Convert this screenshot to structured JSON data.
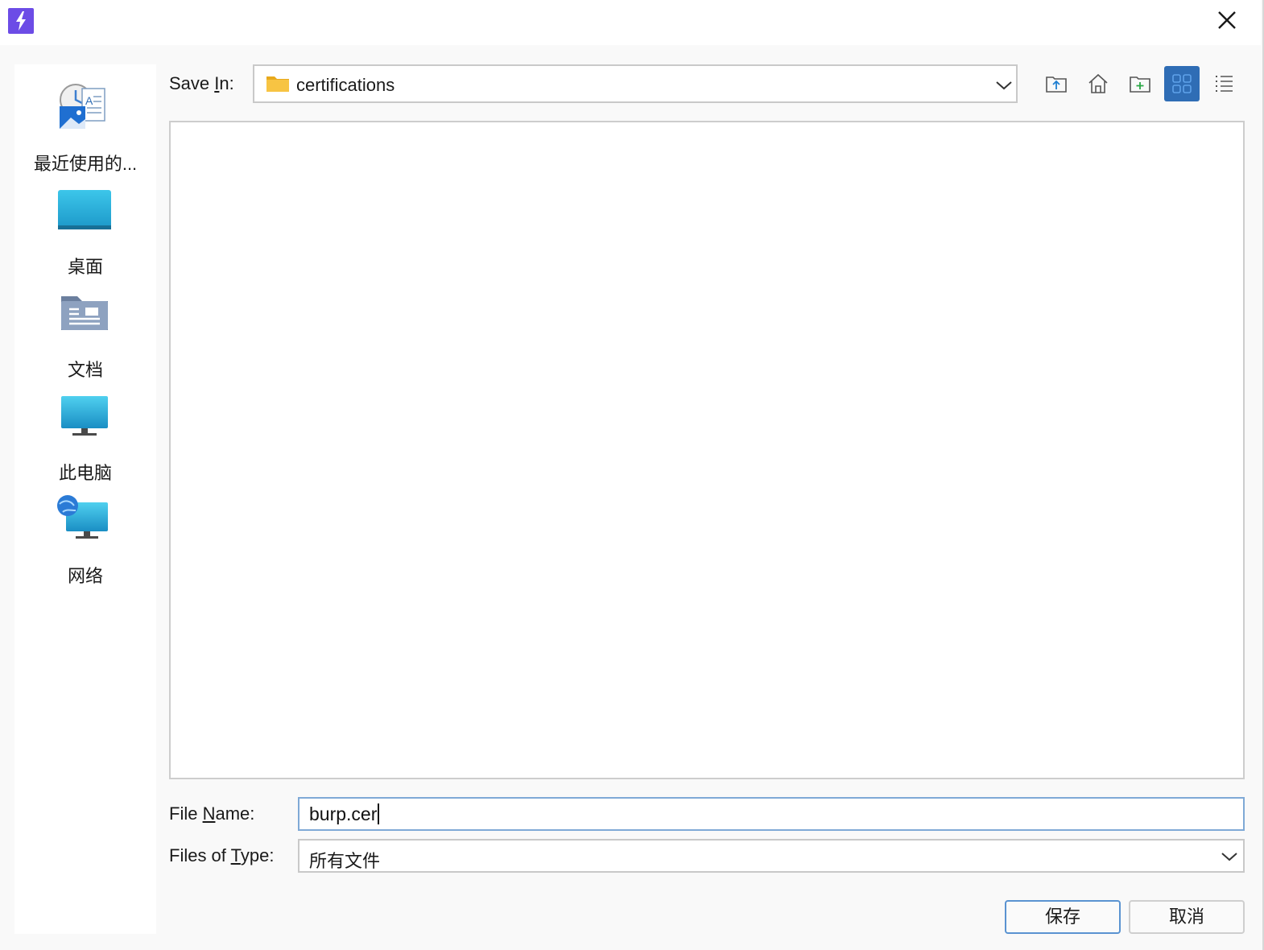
{
  "dialog": {
    "close_glyph": "✕"
  },
  "places": [
    {
      "label": "最近使用的...",
      "icon": "recent-items-icon"
    },
    {
      "label": "桌面",
      "icon": "desktop-icon"
    },
    {
      "label": "文档",
      "icon": "documents-icon"
    },
    {
      "label": "此电脑",
      "icon": "this-pc-icon"
    },
    {
      "label": "网络",
      "icon": "network-icon"
    }
  ],
  "save_in": {
    "label_prefix": "Save ",
    "label_mnemonic": "I",
    "label_suffix": "n:",
    "value": "certifications"
  },
  "toolbar": [
    {
      "name": "up-folder-icon"
    },
    {
      "name": "home-icon"
    },
    {
      "name": "new-folder-icon"
    },
    {
      "name": "grid-view-icon",
      "active": true
    },
    {
      "name": "list-view-icon"
    }
  ],
  "file_name": {
    "label_prefix": "File ",
    "label_mnemonic": "N",
    "label_suffix": "ame:",
    "value": "burp.cer"
  },
  "file_type": {
    "label_prefix": "Files of ",
    "label_mnemonic": "T",
    "label_suffix": "ype:",
    "value": "所有文件"
  },
  "buttons": {
    "save": "保存",
    "cancel": "取消"
  },
  "colors": {
    "accent": "#2f6db5",
    "app_icon": "#6c4ce6",
    "folder": "#f7c443"
  }
}
